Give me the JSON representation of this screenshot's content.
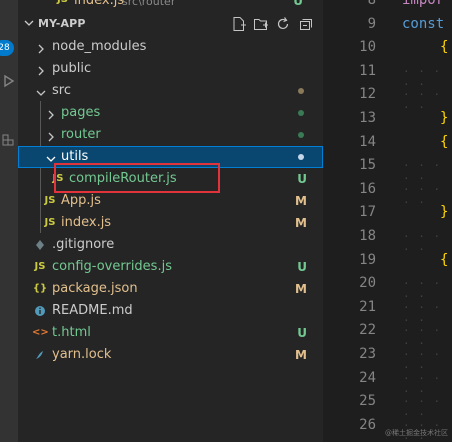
{
  "open_editor": {
    "icon": "JS",
    "name": "index.js",
    "path": "src\\router",
    "status": "U"
  },
  "explorer": {
    "title": "MY-APP"
  },
  "activity": {
    "badge": "28"
  },
  "tree": [
    {
      "label": "node_modules",
      "color": "#cccccc"
    },
    {
      "label": "public",
      "color": "#cccccc"
    },
    {
      "label": "src",
      "color": "#cccccc"
    },
    {
      "label": "pages",
      "color": "#73c991"
    },
    {
      "label": "router",
      "color": "#73c991"
    },
    {
      "label": "utils",
      "color": "#73c991"
    },
    {
      "label": "compileRouter.js",
      "icon": "JS",
      "status": "U",
      "color": "#73c991"
    },
    {
      "label": "App.js",
      "icon": "JS",
      "status": "M",
      "color": "#e2c08d"
    },
    {
      "label": "index.js",
      "icon": "JS",
      "status": "M",
      "color": "#e2c08d"
    },
    {
      "label": ".gitignore",
      "color": "#cccccc"
    },
    {
      "label": "config-overrides.js",
      "icon": "JS",
      "status": "U",
      "color": "#73c991"
    },
    {
      "label": "package.json",
      "icon": "{}",
      "status": "M",
      "color": "#e2c08d"
    },
    {
      "label": "README.md",
      "color": "#cccccc"
    },
    {
      "label": "t.html",
      "icon": "<>",
      "status": "U",
      "color": "#73c991"
    },
    {
      "label": "yarn.lock",
      "status": "M",
      "color": "#e2c08d"
    }
  ],
  "editor": {
    "line_numbers": [
      "8",
      "9",
      "10",
      "11",
      "12",
      "13",
      "14",
      "15",
      "16",
      "17",
      "18",
      "19",
      "20",
      "21",
      "22",
      "23",
      "24",
      "25",
      "26"
    ],
    "code": [
      {
        "line": "8",
        "text": "impor",
        "color": "#c586c0"
      },
      {
        "line": "9",
        "text": "const",
        "color": "#569cd6"
      },
      {
        "line": "10",
        "text": "{",
        "color": "#ffd700"
      },
      {
        "line": "13",
        "text": "}",
        "color": "#ffd700"
      },
      {
        "line": "14",
        "text": "{",
        "color": "#ffd700"
      },
      {
        "line": "17",
        "text": "}",
        "color": "#ffd700"
      },
      {
        "line": "19",
        "text": "{",
        "color": "#ffd700"
      }
    ],
    "watermark": "@稀土掘金技术社区"
  },
  "colors": {
    "accent": "#007acc",
    "selection": "#094771",
    "added": "#73c991",
    "modified": "#e2c08d",
    "highlight_box": "#e0333c"
  }
}
